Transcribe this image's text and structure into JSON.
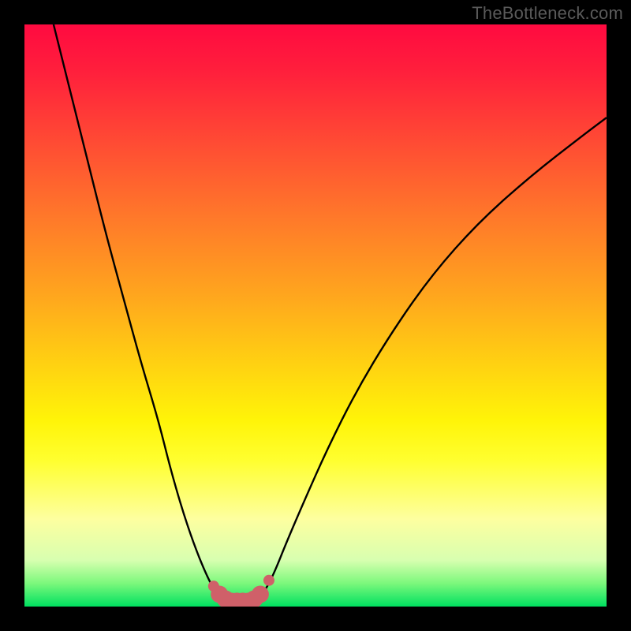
{
  "watermark": "TheBottleneck.com",
  "chart_data": {
    "type": "line",
    "title": "",
    "xlabel": "",
    "ylabel": "",
    "xlim": [
      0,
      100
    ],
    "ylim": [
      0,
      100
    ],
    "series": [
      {
        "name": "left-curve",
        "x": [
          5,
          8,
          11,
          14,
          17,
          20,
          23,
          25,
          27,
          29,
          31,
          32.5,
          34
        ],
        "y": [
          100,
          88,
          76,
          64,
          53,
          42,
          32,
          24,
          17,
          11,
          6,
          3,
          1
        ]
      },
      {
        "name": "right-curve",
        "x": [
          40,
          41.5,
          43,
          45,
          48,
          52,
          57,
          63,
          70,
          78,
          87,
          96,
          100
        ],
        "y": [
          1,
          3,
          6,
          11,
          18,
          27,
          37,
          47,
          57,
          66,
          74,
          81,
          84
        ]
      },
      {
        "name": "safe-zone-markers",
        "x": [
          32.5,
          33.5,
          34.5,
          35.5,
          36.5,
          37.5,
          38.5,
          39.5,
          40.5,
          42.0
        ],
        "y": [
          3.5,
          2.1,
          1.3,
          0.9,
          0.9,
          0.9,
          0.9,
          1.3,
          2.1,
          4.5
        ]
      }
    ],
    "marker_color": "#cf6069",
    "curve_color": "#000000"
  }
}
